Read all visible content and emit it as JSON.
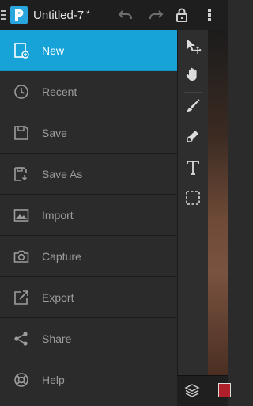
{
  "app": {
    "document_title": "Untitled-7",
    "dirty_marker": "*"
  },
  "colors": {
    "accent": "#17a3d8",
    "drawer_bg": "#2b2b2b",
    "label": "#9c9c9c"
  },
  "toolbar": {
    "icons": [
      "hamburger-icon",
      "app-logo",
      "undo-icon",
      "redo-icon",
      "lock-icon",
      "overflow-menu-icon"
    ]
  },
  "drawer": {
    "items": [
      {
        "label": "New",
        "icon": "new-document-icon",
        "active": true
      },
      {
        "label": "Recent",
        "icon": "clock-icon",
        "active": false
      },
      {
        "label": "Save",
        "icon": "save-icon",
        "active": false
      },
      {
        "label": "Save As",
        "icon": "save-as-icon",
        "active": false
      },
      {
        "label": "Import",
        "icon": "image-import-icon",
        "active": false
      },
      {
        "label": "Capture",
        "icon": "camera-icon",
        "active": false
      },
      {
        "label": "Export",
        "icon": "export-icon",
        "active": false
      },
      {
        "label": "Share",
        "icon": "share-icon",
        "active": false
      },
      {
        "label": "Help",
        "icon": "help-lifebuoy-icon",
        "active": false
      }
    ]
  },
  "tools": [
    "move-tool-icon",
    "hand-tool-icon",
    "brush-tool-icon",
    "eraser-tool-icon",
    "text-tool-icon",
    "selection-tool-icon"
  ],
  "bottom": {
    "icons": [
      "layers-icon",
      "layer-thumbnail"
    ]
  }
}
